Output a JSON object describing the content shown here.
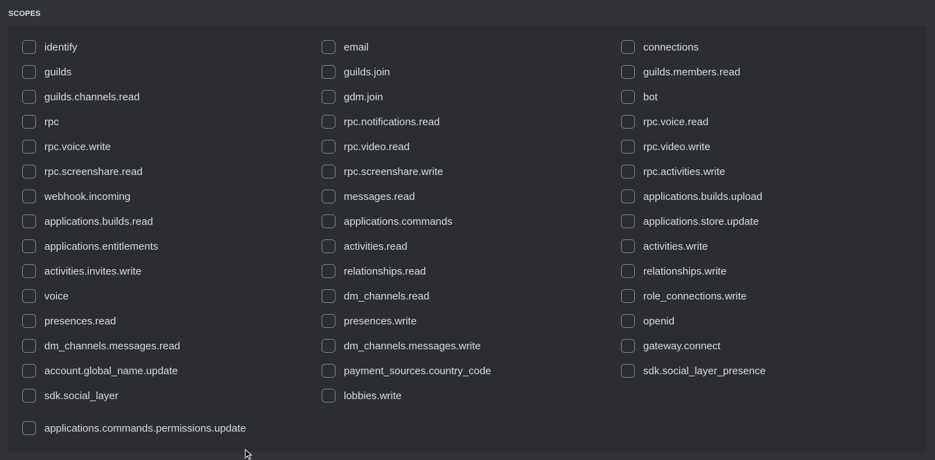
{
  "section": {
    "title": "SCOPES"
  },
  "scopes": [
    {
      "label": "identify",
      "checked": false
    },
    {
      "label": "email",
      "checked": false
    },
    {
      "label": "connections",
      "checked": false
    },
    {
      "label": "guilds",
      "checked": false
    },
    {
      "label": "guilds.join",
      "checked": false
    },
    {
      "label": "guilds.members.read",
      "checked": false
    },
    {
      "label": "guilds.channels.read",
      "checked": false
    },
    {
      "label": "gdm.join",
      "checked": false
    },
    {
      "label": "bot",
      "checked": false
    },
    {
      "label": "rpc",
      "checked": false
    },
    {
      "label": "rpc.notifications.read",
      "checked": false
    },
    {
      "label": "rpc.voice.read",
      "checked": false
    },
    {
      "label": "rpc.voice.write",
      "checked": false
    },
    {
      "label": "rpc.video.read",
      "checked": false
    },
    {
      "label": "rpc.video.write",
      "checked": false
    },
    {
      "label": "rpc.screenshare.read",
      "checked": false
    },
    {
      "label": "rpc.screenshare.write",
      "checked": false
    },
    {
      "label": "rpc.activities.write",
      "checked": false
    },
    {
      "label": "webhook.incoming",
      "checked": false
    },
    {
      "label": "messages.read",
      "checked": false
    },
    {
      "label": "applications.builds.upload",
      "checked": false
    },
    {
      "label": "applications.builds.read",
      "checked": false
    },
    {
      "label": "applications.commands",
      "checked": false
    },
    {
      "label": "applications.store.update",
      "checked": false
    },
    {
      "label": "applications.entitlements",
      "checked": false
    },
    {
      "label": "activities.read",
      "checked": false
    },
    {
      "label": "activities.write",
      "checked": false
    },
    {
      "label": "activities.invites.write",
      "checked": false
    },
    {
      "label": "relationships.read",
      "checked": false
    },
    {
      "label": "relationships.write",
      "checked": false
    },
    {
      "label": "voice",
      "checked": false
    },
    {
      "label": "dm_channels.read",
      "checked": false
    },
    {
      "label": "role_connections.write",
      "checked": false
    },
    {
      "label": "presences.read",
      "checked": false
    },
    {
      "label": "presences.write",
      "checked": false
    },
    {
      "label": "openid",
      "checked": false
    },
    {
      "label": "dm_channels.messages.read",
      "checked": false
    },
    {
      "label": "dm_channels.messages.write",
      "checked": false
    },
    {
      "label": "gateway.connect",
      "checked": false
    },
    {
      "label": "account.global_name.update",
      "checked": false
    },
    {
      "label": "payment_sources.country_code",
      "checked": false
    },
    {
      "label": "sdk.social_layer_presence",
      "checked": false
    },
    {
      "label": "sdk.social_layer",
      "checked": false
    },
    {
      "label": "lobbies.write",
      "checked": false
    }
  ],
  "extra_scope": {
    "label": "applications.commands.permissions.update",
    "checked": false
  },
  "colors": {
    "background": "#313338",
    "panel": "#2b2d31",
    "checkbox_border": "#80848e",
    "text": "#dbdee1"
  }
}
